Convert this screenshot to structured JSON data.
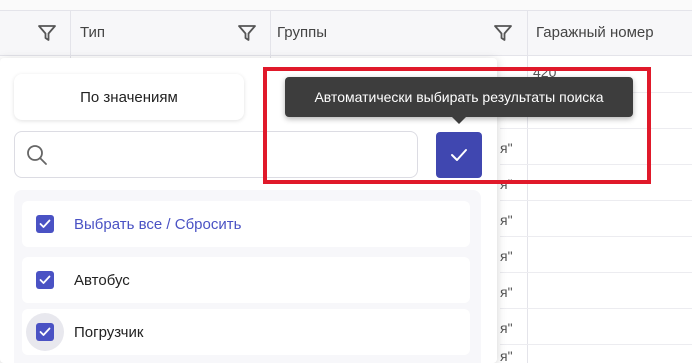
{
  "table": {
    "columns": [
      {
        "label": "Тип"
      },
      {
        "label": "Группы"
      },
      {
        "label": "Гаражный номер"
      }
    ],
    "cell_fragments": [
      "420",
      "я\"",
      "я\"",
      "я\"",
      "я\"",
      "я\"",
      "я\"",
      "я\""
    ]
  },
  "filter_panel": {
    "mode_tab": "По значениям",
    "search": {
      "value": "",
      "placeholder": ""
    },
    "tooltip": "Автоматически выбирать результаты поиска",
    "items": [
      {
        "label": "Выбрать все / Сбросить",
        "checked": true
      },
      {
        "label": "Автобус",
        "checked": true
      },
      {
        "label": "Погрузчик",
        "checked": true
      }
    ]
  },
  "icons": {
    "filter": "filter-funnel-icon",
    "search": "magnifier-icon",
    "check": "checkmark-icon"
  },
  "colors": {
    "accent": "#4a52c4",
    "button": "#4047b0",
    "tooltip_bg": "#3d3d3d",
    "highlight": "#e0192a"
  }
}
